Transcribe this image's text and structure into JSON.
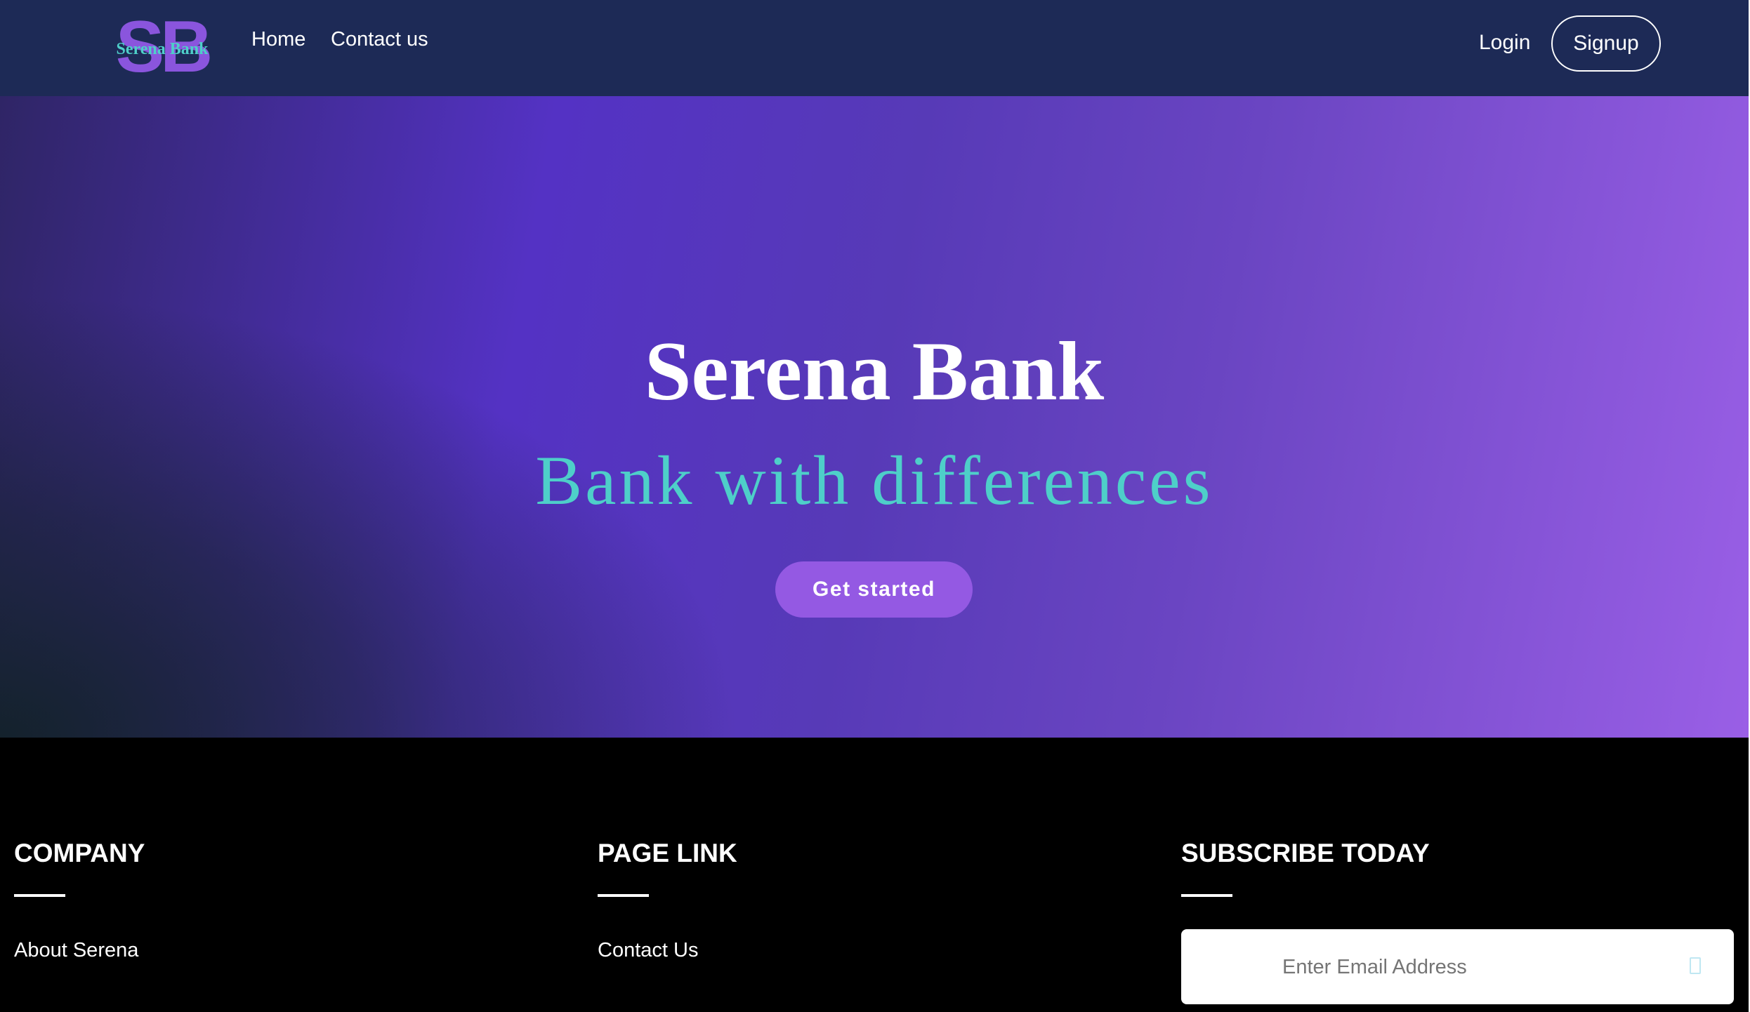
{
  "logo": {
    "monogram": "SB",
    "text": "Serena Bank",
    "colors": {
      "monogram": "#8a55dd",
      "text": "#4ecfc9"
    }
  },
  "nav": {
    "links": [
      {
        "label": "Home"
      },
      {
        "label": "Contact us"
      }
    ],
    "login_label": "Login",
    "signup_label": "Signup"
  },
  "hero": {
    "title": "Serena Bank",
    "subtitle": "Bank with differences",
    "cta_label": "Get started"
  },
  "footer": {
    "columns": [
      {
        "heading": "COMPANY",
        "link": "About Serena"
      },
      {
        "heading": "PAGE LINK",
        "link": "Contact Us"
      },
      {
        "heading": "SUBSCRIBE TODAY"
      }
    ],
    "subscribe": {
      "placeholder": "Enter Email Address",
      "value": "",
      "icon": "send-icon"
    }
  },
  "colors": {
    "navbar_bg": "#1d2a56",
    "hero_accent": "#5432c4",
    "subtitle": "#4ecfc9",
    "button": "#9459e3",
    "footer_bg": "#000000"
  }
}
